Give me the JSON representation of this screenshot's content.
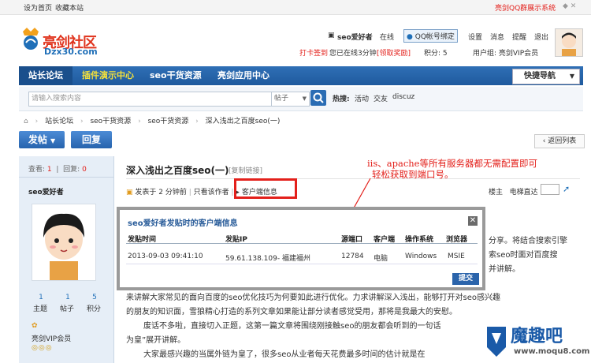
{
  "topbar": {
    "set_home": "设为首页",
    "bookmark": "收藏本站",
    "qq_group": "亮剑QQ群展示系统"
  },
  "header": {
    "logo_text": "亮剑社区",
    "logo_sub": "Dzx30.com",
    "username": "seo爱好者",
    "online": "在线",
    "qq_bind": "QQ帐号绑定",
    "settings": "设置",
    "messages": "消息",
    "remind": "提醒",
    "logout": "退出",
    "checkin": "打卡签到",
    "online_time": "您已在线3分钟",
    "claim": "[领取奖励]",
    "points": "积分: 5",
    "group": "用户组: 亮剑VIP会员"
  },
  "nav": {
    "home": "站长论坛",
    "items": [
      "插件演示中心",
      "seo干货资源",
      "亮剑应用中心"
    ],
    "quick_nav": "快捷导航"
  },
  "search": {
    "placeholder": "请输入搜索内容",
    "type": "帖子",
    "hot_label": "热搜:",
    "hot": [
      "活动",
      "交友",
      "discuz"
    ]
  },
  "breadcrumb": [
    "站长论坛",
    "seo干货资源",
    "seo干货资源",
    "深入浅出之百度seo(一)"
  ],
  "actions": {
    "post": "发帖",
    "reply": "回复",
    "back": "返回列表"
  },
  "stats": {
    "views_label": "查看:",
    "views": "1",
    "replies_label": "回复:",
    "replies": "0"
  },
  "author": {
    "name": "seo爱好者",
    "topics": "1",
    "topics_label": "主题",
    "posts": "1",
    "posts_label": "帖子",
    "points": "5",
    "points_label": "积分",
    "group": "亮剑VIP会员"
  },
  "post": {
    "title": "深入浅出之百度seo(一)",
    "copy_link": "[复制链接]",
    "posted": "发表于 2 分钟前",
    "only_author": "只看该作者",
    "client_info": "客户端信息",
    "floor_label": "楼主",
    "direct": "电梯直达",
    "lines": [
      "分享。将结合搜索引擎",
      "索seo时面对百度搜",
      "并讲解。",
      "来讲解大家常见的面向百度的seo优化技巧为何要如此进行优化。力求讲解深入浅出，能够打开对seo感兴趣",
      "的朋友的知识面，雪狼精心打造的系列文章如果能让部分读者感觉受用，那将是我最大的安慰。",
      "废话不多啦，直接切入正题，这第一篇文章将围绕刚接触seo的朋友都会听到的一句话",
      "为皇”展开讲解。",
      "大家最感兴趣的当属外链为皇了，很多seo从业者每天花费最多时间的估计就是在"
    ]
  },
  "annotation": {
    "line1": "iis、apache等所有服务器都无需配置即可",
    "line2": "轻松获取到端口号。"
  },
  "popup": {
    "title": "seo爱好者发贴时的客户端信息",
    "headers": {
      "time": "发贴时间",
      "ip": "发贴IP",
      "port": "源端口",
      "client": "客户端",
      "os": "操作系统",
      "browser": "浏览器"
    },
    "row": {
      "time": "2013-09-03 09:41:10",
      "ip": "59.61.138.109- 福建福州",
      "port": "12784",
      "client": "电脑",
      "os": "Windows",
      "browser": "MSIE"
    },
    "submit": "提交"
  },
  "watermark": {
    "text": "魔趣吧",
    "url": "www.moqu8.com"
  }
}
